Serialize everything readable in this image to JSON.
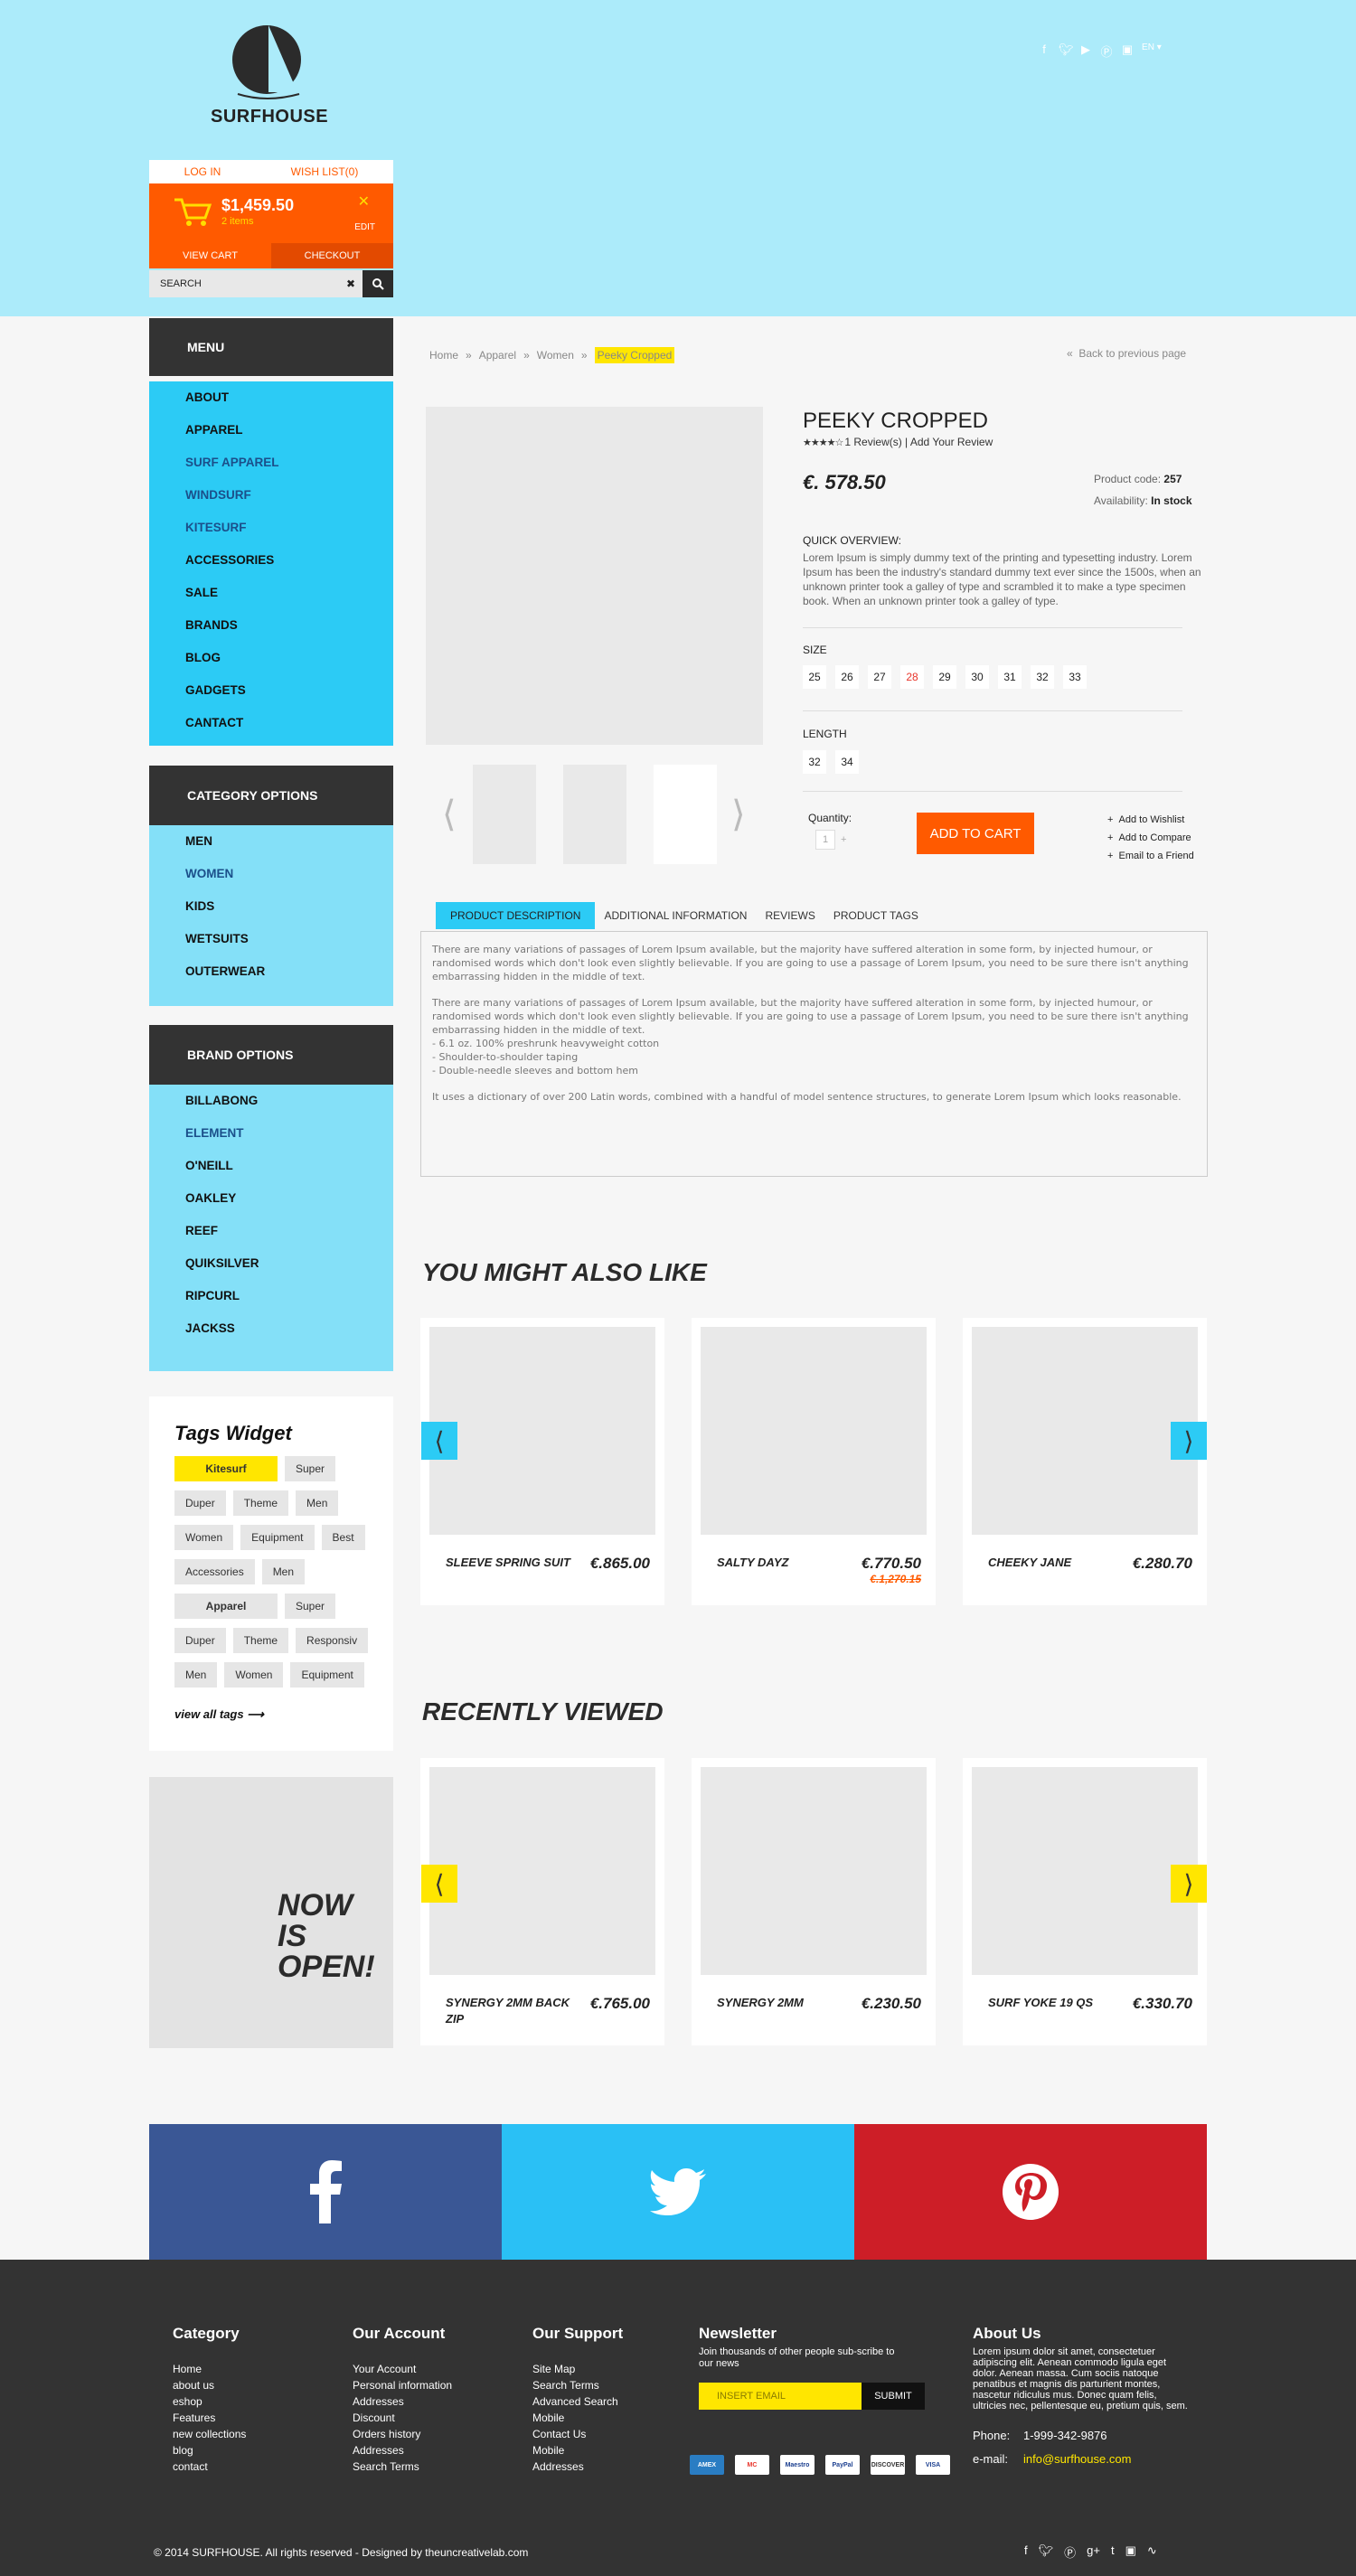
{
  "header": {
    "brand": "SURFHOUSE",
    "social_icons": [
      "facebook-icon",
      "twitter-icon",
      "youtube-icon",
      "pinterest-icon",
      "instagram-icon"
    ],
    "language": "EN",
    "login": "LOG IN",
    "wishlist": "WISH LIST(0)",
    "cart_amount": "$1,459.50",
    "cart_items": "2 items",
    "cart_edit": "EDIT",
    "view_cart": "VIEW CART",
    "checkout": "CHECKOUT",
    "search_placeholder": "SEARCH"
  },
  "sidebar": {
    "menu_title": "MENU",
    "menu": [
      "ABOUT",
      "APPAREL",
      "SURF APPAREL",
      "WINDSURF",
      "KITESURF",
      "ACCESSORIES",
      "SALE",
      "BRANDS",
      "BLOG",
      "GADGETS",
      "CANTACT"
    ],
    "category_title": "CATEGORY OPTIONS",
    "categories": [
      "MEN",
      "WOMEN",
      "KIDS",
      "WETSUITS",
      "OUTERWEAR"
    ],
    "brand_title": "BRAND OPTIONS",
    "brands": [
      "BILLABONG",
      "ELEMENT",
      "O'NEILL",
      "OAKLEY",
      "REEF",
      "QUIKSILVER",
      "RIPCURL",
      "JACKSS"
    ],
    "tags_title": "Tags Widget",
    "tags": [
      "Kitesurf",
      "Super",
      "Duper",
      "Theme",
      "Men",
      "Women",
      "Equipment",
      "Best",
      "Accessories",
      "Men",
      "Apparel",
      "Super",
      "Duper",
      "Theme",
      "Responsiv",
      "Men",
      "Women",
      "Equipment"
    ],
    "view_all_tags": "view all tags",
    "promo_l1": "NOW",
    "promo_l2": "IS",
    "promo_l3": "OPEN!"
  },
  "breadcrumb": [
    "Home",
    "Apparel",
    "Women",
    "Peeky Cropped"
  ],
  "back_link": "Back to previous page",
  "product": {
    "title": "PEEKY CROPPED",
    "rating": 4,
    "reviews": "1 Review(s) | Add Your Review",
    "price": "€. 578.50",
    "code_label": "Product code:",
    "code": "257",
    "availability_label": "Availability:",
    "availability": "In stock",
    "overview_label": "QUICK OVERVIEW:",
    "overview": "Lorem Ipsum is simply dummy text of the printing and typesetting industry. Lorem Ipsum has been the industry's standard dummy text ever since the 1500s, when an unknown printer took a galley of type and scrambled it to make a type specimen book. When an unknown printer took a galley of type.",
    "size_label": "SIZE",
    "sizes": [
      "25",
      "26",
      "27",
      "28",
      "29",
      "30",
      "31",
      "32",
      "33"
    ],
    "length_label": "LENGTH",
    "lengths": [
      "32",
      "34"
    ],
    "quantity_label": "Quantity:",
    "quantity": "1",
    "add_to_cart": "ADD TO CART",
    "wishlist": "Add to Wishlist",
    "compare": "Add to Compare",
    "email": "Email to a Friend"
  },
  "tabs": [
    "PRODUCT DESCRIPTION",
    "ADDITIONAL INFORMATION",
    "REVIEWS",
    "PRODUCT TAGS"
  ],
  "description": {
    "p1": "There are many variations of passages of Lorem Ipsum available, but the majority have suffered alteration in some form, by injected humour, or randomised words which don't look even slightly believable. If you are going to use a passage of Lorem Ipsum, you need to be sure there isn't anything embarrassing hidden in the middle of text.",
    "p2": "There are many variations of passages of Lorem Ipsum available, but the majority have suffered alteration in some form, by injected humour, or randomised words which don't look even slightly believable. If you are going to use a passage of Lorem Ipsum, you need to be sure there isn't anything embarrassing hidden in the middle of text.",
    "b1": "- 6.1 oz. 100% preshrunk heavyweight cotton",
    "b2": "- Shoulder-to-shoulder taping",
    "b3": "- Double-needle sleeves and bottom hem",
    "p3": "It uses a dictionary of over 200 Latin words, combined with a handful of model sentence structures, to generate Lorem Ipsum which looks reasonable."
  },
  "might_like": {
    "title": "YOU MIGHT ALSO LIKE",
    "items": [
      {
        "name": "SLEEVE SPRING SUIT",
        "price": "€.865.00",
        "old": ""
      },
      {
        "name": "SALTY DAYZ",
        "price": "€.770.50",
        "old": "€.1,270.15"
      },
      {
        "name": "CHEEKY JANE",
        "price": "€.280.70",
        "old": ""
      }
    ]
  },
  "recent": {
    "title": "RECENTLY VIEWED",
    "items": [
      {
        "name": "SYNERGY 2MM BACK ZIP",
        "price": "€.765.00"
      },
      {
        "name": "SYNERGY 2MM",
        "price": "€.230.50"
      },
      {
        "name": "SURF YOKE 19 QS",
        "price": "€.330.70"
      }
    ]
  },
  "colors": {
    "facebook": "#3a5795",
    "twitter": "#2ac0f5",
    "pinterest": "#cd1e27",
    "accent": "#ff5a00",
    "cyan": "#2ccbf5",
    "yellow": "#ffe600"
  },
  "footer": {
    "category_title": "Category",
    "category": [
      "Home",
      "about us",
      "eshop",
      "Features",
      "new collections",
      "blog",
      "contact"
    ],
    "account_title": "Our Account",
    "account": [
      "Your Account",
      "Personal information",
      "Addresses",
      "Discount",
      "Orders history",
      "Addresses",
      "Search Terms"
    ],
    "support_title": "Our Support",
    "support": [
      "Site Map",
      "Search Terms",
      "Advanced Search",
      "Mobile",
      "Contact Us",
      "Mobile",
      "Addresses"
    ],
    "newsletter_title": "Newsletter",
    "newsletter_sub": "Join thousands of other people sub-scribe to our news",
    "email_placeholder": "INSERT EMAIL",
    "submit": "SUBMIT",
    "payments": [
      "AMEX",
      "MC",
      "Maestro",
      "PayPal",
      "DISCOVER",
      "VISA"
    ],
    "about_title": "About Us",
    "about_text": "Lorem ipsum dolor sit amet, consectetuer adipiscing elit. Aenean commodo ligula eget dolor. Aenean massa. Cum sociis natoque penatibus et magnis dis parturient montes, nascetur ridiculus mus. Donec quam felis, ultricies nec, pellentesque eu, pretium quis, sem.",
    "phone_label": "Phone:",
    "phone": "1-999-342-9876",
    "email_label": "e-mail:",
    "email": "info@surfhouse.com",
    "copyright": "© 2014  SURFHOUSE. All rights reserved - Designed by theuncreativelab.com",
    "social_icons": [
      "facebook-icon",
      "twitter-icon",
      "pinterest-icon",
      "googleplus-icon",
      "tumblr-icon",
      "instagram-icon",
      "rss-icon"
    ]
  }
}
